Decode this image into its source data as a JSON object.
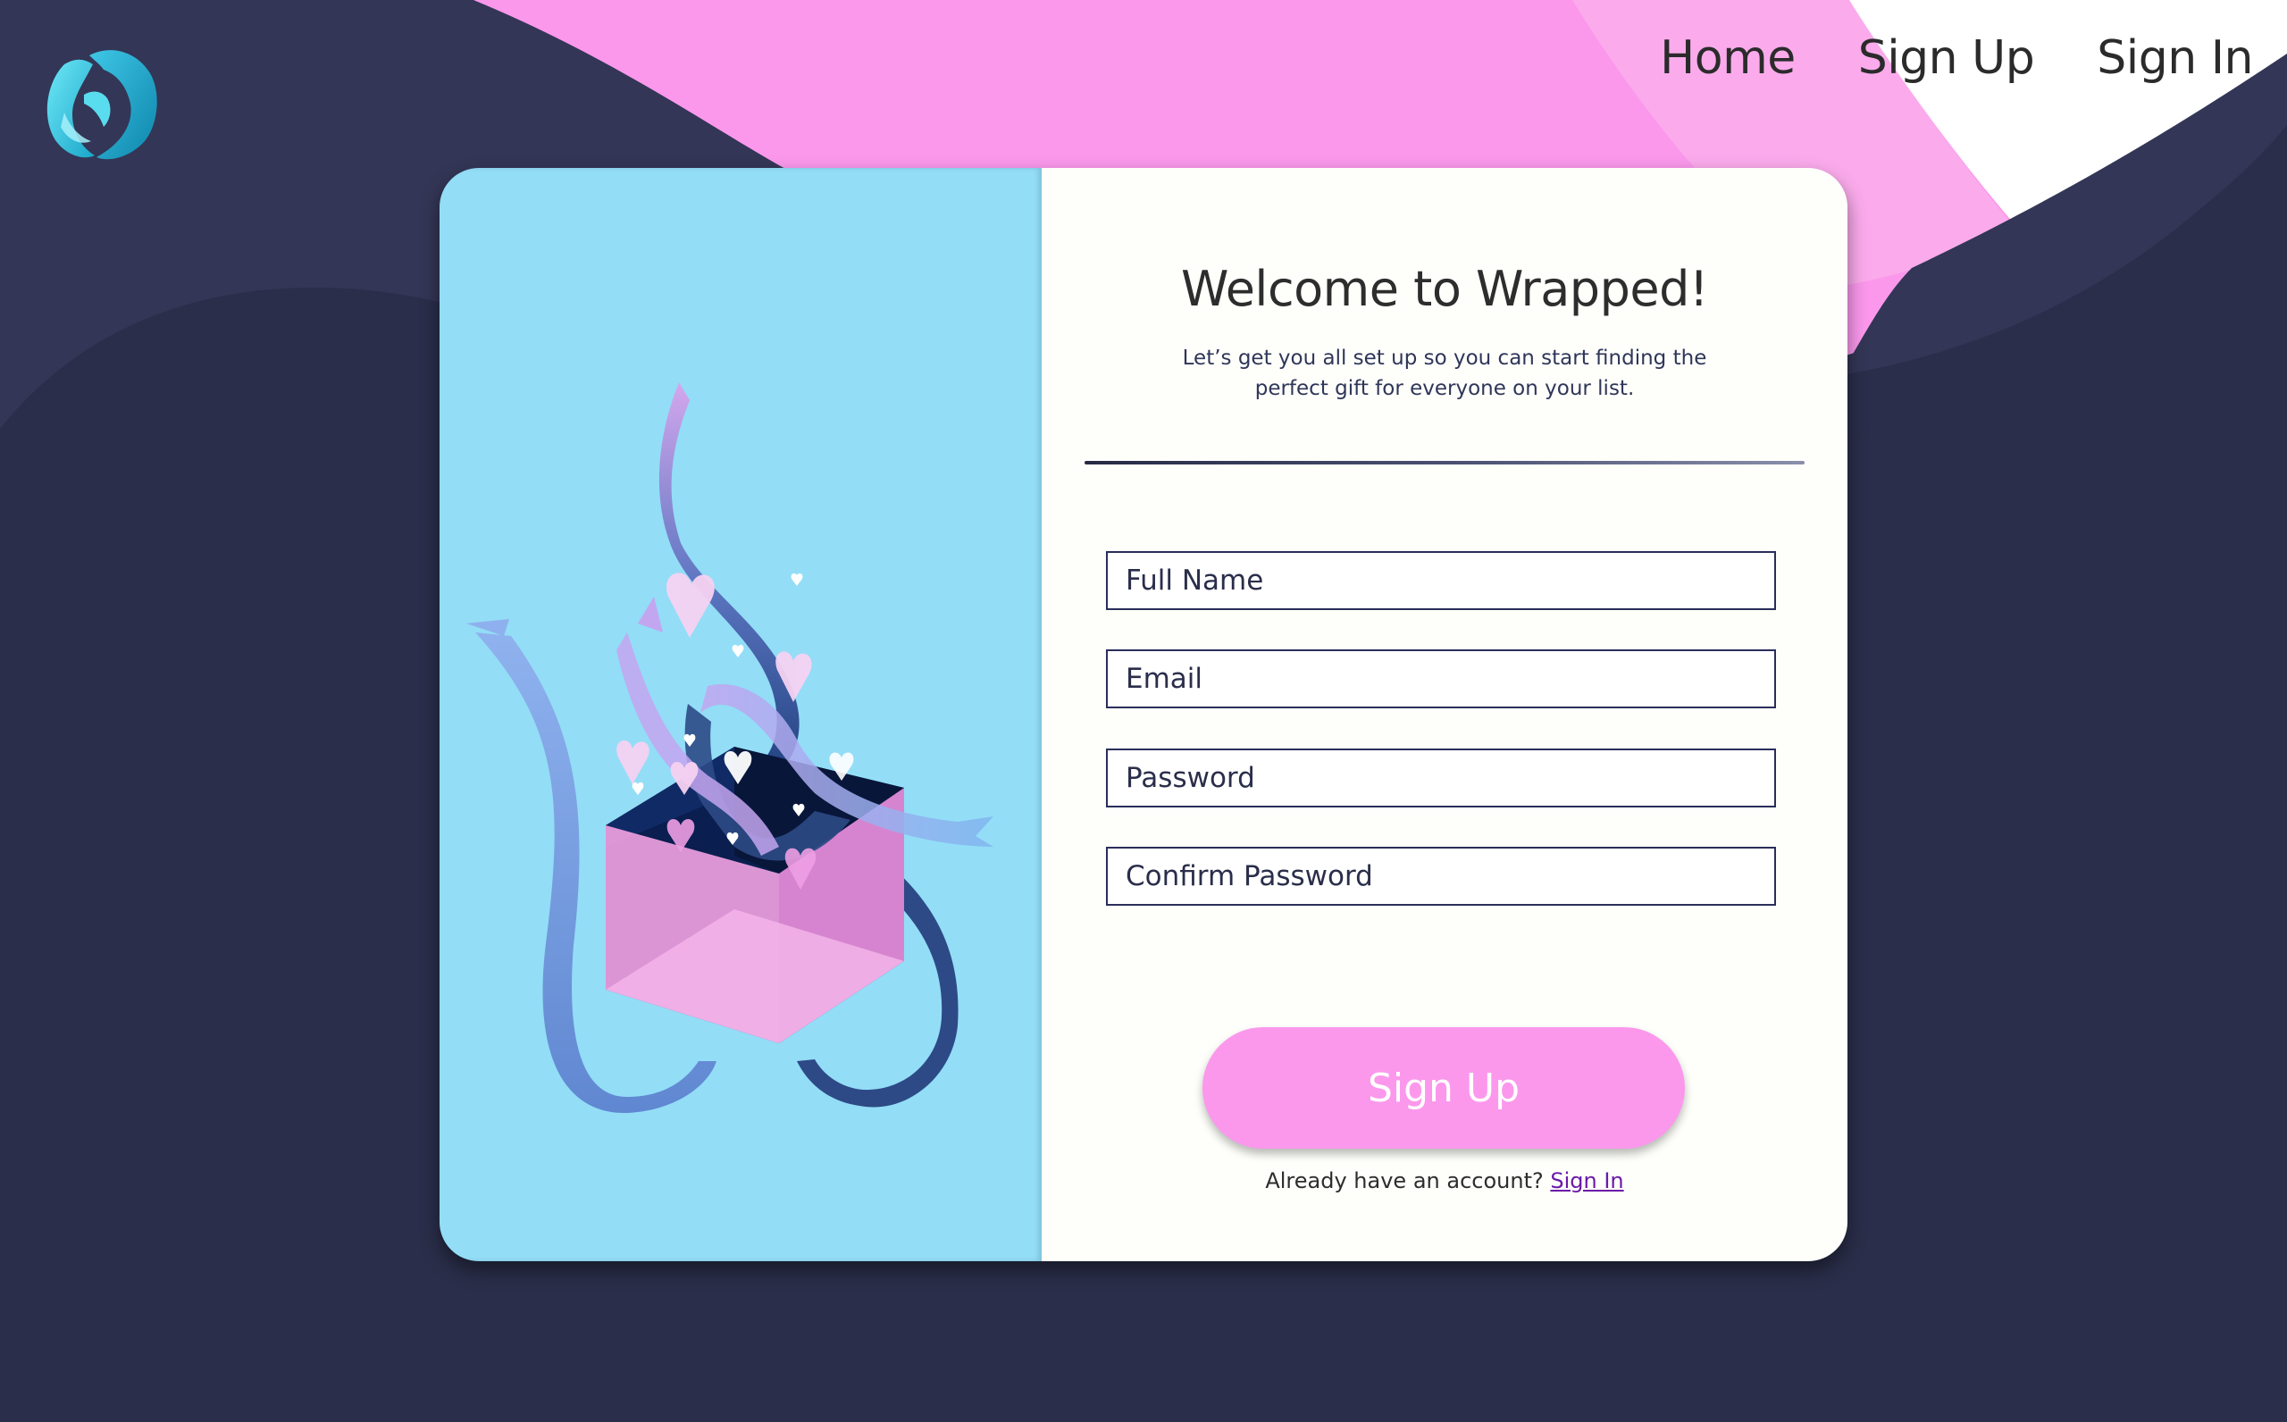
{
  "nav": {
    "links": [
      "Home",
      "Sign Up",
      "Sign In"
    ]
  },
  "logo": {
    "icon": "wrapped-logo-icon"
  },
  "illustration": {
    "icon": "gift-box-with-ribbons-and-hearts-icon"
  },
  "form": {
    "title": "Welcome to Wrapped!",
    "subtitle": "Let’s get you all set up so you can start finding the perfect gift for everyone on your list.",
    "fields": [
      {
        "placeholder": "Full Name",
        "type": "text"
      },
      {
        "placeholder": "Email",
        "type": "email"
      },
      {
        "placeholder": "Password",
        "type": "password"
      },
      {
        "placeholder": "Confirm Password",
        "type": "password"
      }
    ],
    "submit_label": "Sign Up",
    "already_text": "Already have an account?",
    "signin_link": "Sign In"
  },
  "colors": {
    "background": "#2a2e4a",
    "accent_pink": "#fb98ec",
    "panel_blue": "#93ddf7",
    "card_white": "#fefffb",
    "link_purple": "#6b1aa8"
  }
}
